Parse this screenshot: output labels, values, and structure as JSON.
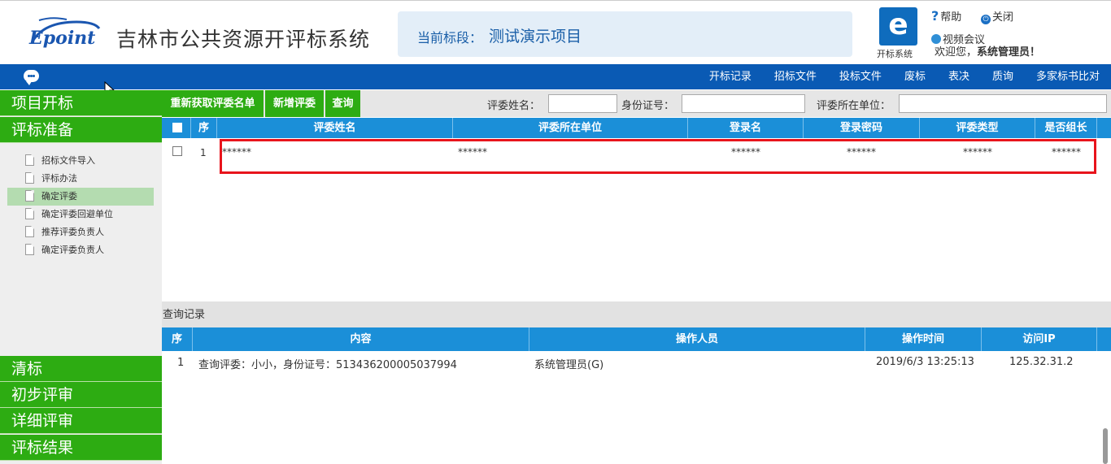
{
  "header": {
    "logo_text": "Epoint",
    "system_title": "吉林市公共资源开评标系统",
    "stage_label": "当前标段：",
    "stage_value": "测试演示项目",
    "app_icon_letter": "e",
    "app_icon_caption": "开标系统",
    "help_label": "帮助",
    "close_label": "关闭",
    "video_label": "视频会议",
    "welcome_prefix": "欢迎您，",
    "welcome_user": "系统管理员！"
  },
  "nav": {
    "items": [
      "开标记录",
      "招标文件",
      "投标文件",
      "废标",
      "表决",
      "质询",
      "多家标书比对"
    ]
  },
  "sidebar": {
    "sections_top": [
      "项目开标",
      "评标准备"
    ],
    "tree_items": [
      "招标文件导入",
      "评标办法",
      "确定评委",
      "确定评委回避单位",
      "推荐评委负责人",
      "确定评委负责人"
    ],
    "active_index": 2,
    "sections_bottom": [
      "清标",
      "初步评审",
      "详细评审",
      "评标结果"
    ]
  },
  "toolbar": {
    "buttons": [
      "重新获取评委名单",
      "新增评委",
      "查询"
    ],
    "filters": {
      "name_label": "评委姓名：",
      "id_label": "身份证号：",
      "unit_label": "评委所在单位："
    }
  },
  "judges_table": {
    "columns": [
      "序",
      "评委姓名",
      "评委所在单位",
      "登录名",
      "登录密码",
      "评委类型",
      "是否组长"
    ],
    "rows": [
      {
        "index": "1",
        "name": "******",
        "unit": "******",
        "login": "******",
        "password": "******",
        "type": "******",
        "leader": "******"
      }
    ]
  },
  "log": {
    "title": "查询记录",
    "columns": [
      "序",
      "内容",
      "操作人员",
      "操作时间",
      "访问IP"
    ],
    "rows": [
      {
        "index": "1",
        "content": "查询评委：小小，身份证号：513436200005037994",
        "operator": "系统管理员(G)",
        "time": "2019/6/3 13:25:13",
        "ip": "125.32.31.2"
      }
    ]
  },
  "colors": {
    "nav_blue": "#0a5ab4",
    "grid_blue": "#1b8fd8",
    "green": "#2dac12",
    "highlight_red": "#e8141c"
  }
}
